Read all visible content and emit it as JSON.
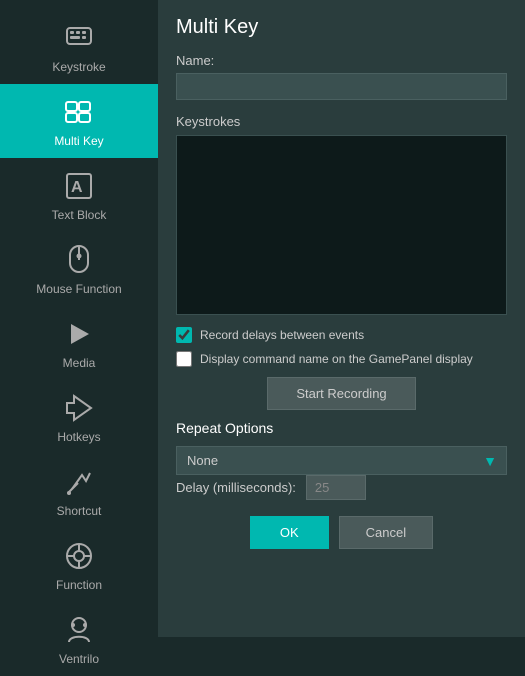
{
  "page": {
    "title": "Multi Key"
  },
  "sidebar": {
    "items": [
      {
        "id": "keystroke",
        "label": "Keystroke",
        "active": false
      },
      {
        "id": "multi-key",
        "label": "Multi Key",
        "active": true
      },
      {
        "id": "text-block",
        "label": "Text Block",
        "active": false
      },
      {
        "id": "mouse-function",
        "label": "Mouse Function",
        "active": false
      },
      {
        "id": "media",
        "label": "Media",
        "active": false
      },
      {
        "id": "hotkeys",
        "label": "Hotkeys",
        "active": false
      },
      {
        "id": "shortcut",
        "label": "Shortcut",
        "active": false
      },
      {
        "id": "function",
        "label": "Function",
        "active": false
      },
      {
        "id": "ventrilo",
        "label": "Ventrilo",
        "active": false
      }
    ]
  },
  "form": {
    "name_label": "Name:",
    "name_placeholder": "",
    "keystrokes_label": "Keystrokes",
    "record_delays_label": "Record delays between events",
    "display_command_label": "Display command name on the GamePanel display",
    "start_recording_label": "Start Recording",
    "repeat_options_title": "Repeat Options",
    "repeat_none": "None",
    "delay_label": "Delay (milliseconds):",
    "delay_value": "25",
    "ok_label": "OK",
    "cancel_label": "Cancel"
  },
  "colors": {
    "accent": "#00b8b0"
  }
}
